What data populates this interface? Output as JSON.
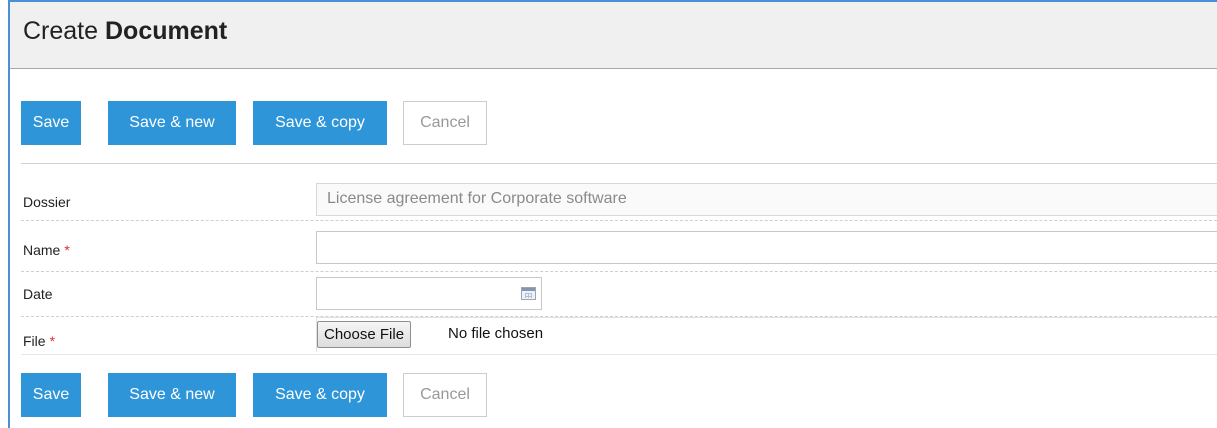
{
  "page": {
    "title_prefix": "Create",
    "title_bold": "Document"
  },
  "actions": {
    "save_label": "Save",
    "save_new_label": "Save & new",
    "save_copy_label": "Save & copy",
    "cancel_label": "Cancel"
  },
  "form": {
    "dossier": {
      "label": "Dossier",
      "value": "License agreement for Corporate software"
    },
    "name": {
      "label": "Name",
      "required_mark": "*",
      "value": ""
    },
    "date": {
      "label": "Date",
      "value": "",
      "icon": "calendar-icon"
    },
    "file": {
      "label": "File",
      "required_mark": "*",
      "button_label": "Choose File",
      "status": "No file chosen"
    }
  },
  "colors": {
    "primary": "#2e95d9",
    "required": "#e0302a",
    "frame": "#4a90d9"
  }
}
